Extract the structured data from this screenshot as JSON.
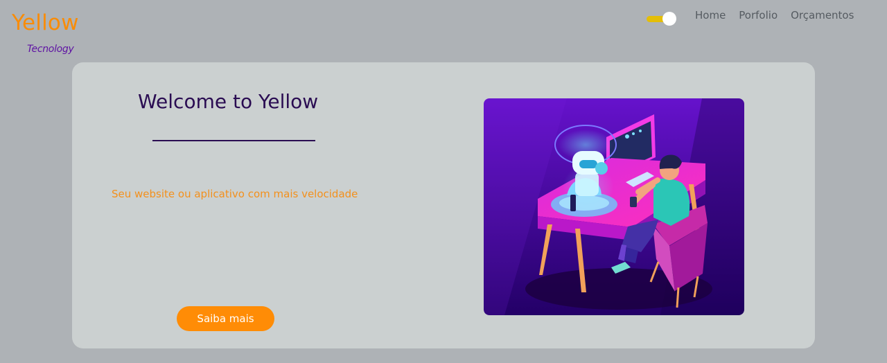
{
  "brand": {
    "title": "Yellow",
    "subtitle": "Tecnology"
  },
  "theme_toggle": {
    "state": "on"
  },
  "nav": {
    "items": [
      {
        "label": "Home"
      },
      {
        "label": "Porfolio"
      },
      {
        "label": "Orçamentos"
      }
    ]
  },
  "hero": {
    "heading": "Welcome to Yellow",
    "tagline": "Seu website ou aplicativo com mais velocidade",
    "cta_label": "Saiba mais",
    "illustration": "person-at-desk-with-robot-illustration"
  },
  "colors": {
    "background": "#aeb2b6",
    "card": "#cbd0d0",
    "brand_orange": "#f98c07",
    "brand_purple": "#5e12a3",
    "heading": "#2a0c52",
    "toggle": "#e4be08"
  }
}
